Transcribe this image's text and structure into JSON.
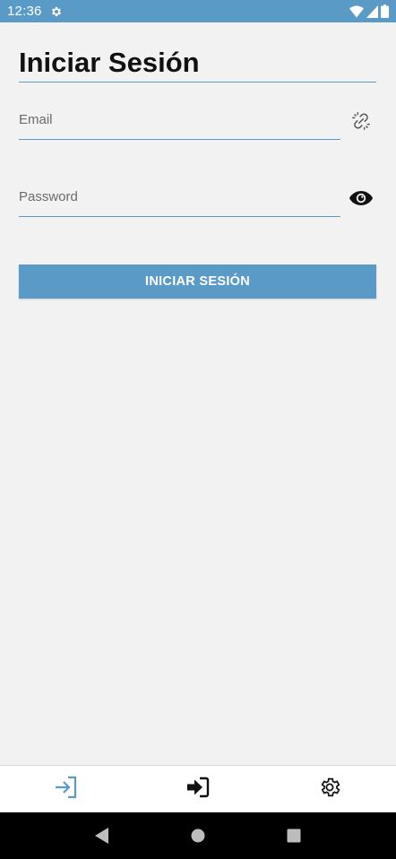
{
  "status_bar": {
    "time": "12:36",
    "icons": [
      "gear-icon",
      "wifi-icon",
      "signal-icon",
      "battery-icon"
    ],
    "background": "#5a9ac6"
  },
  "page": {
    "title": "Iniciar Sesión"
  },
  "form": {
    "email": {
      "placeholder": "Email",
      "value": "",
      "icon": "link-off-icon"
    },
    "password": {
      "placeholder": "Password",
      "value": "",
      "icon": "eye-icon"
    },
    "submit_label": "INICIAR SESIÓN"
  },
  "bottom_tabs": [
    {
      "icon": "login-outline-icon",
      "active": true
    },
    {
      "icon": "login-solid-icon",
      "active": false
    },
    {
      "icon": "settings-icon",
      "active": false
    }
  ],
  "nav_bar": {
    "buttons": [
      "back-icon",
      "home-icon",
      "recents-icon"
    ]
  },
  "colors": {
    "accent": "#5a9ac6",
    "background": "#f2f2f2"
  }
}
